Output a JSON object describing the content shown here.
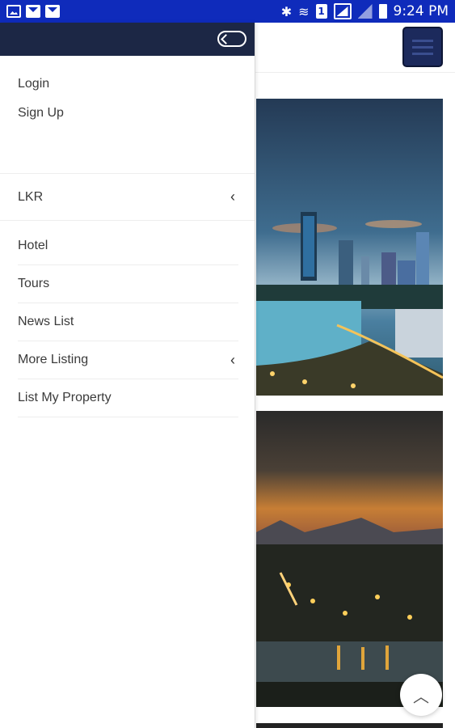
{
  "statusbar": {
    "time": "9:24 PM",
    "sim_label": "1",
    "icons": [
      "image-icon",
      "mail-icon",
      "mail-icon",
      "bluetooth-icon",
      "wifi-icon",
      "sim-icon",
      "signal-icon",
      "signal-icon",
      "battery-icon"
    ]
  },
  "drawer": {
    "auth": {
      "login": "Login",
      "signup": "Sign Up"
    },
    "currency": {
      "label": "LKR"
    },
    "menu": [
      {
        "label": "Hotel"
      },
      {
        "label": "Tours"
      },
      {
        "label": "News List"
      },
      {
        "label": "More Listing"
      },
      {
        "label": "List My Property"
      }
    ]
  },
  "glyphs": {
    "chevron_left": "‹",
    "chevron_up": "︿",
    "bluetooth": "✱",
    "wifi": "≋"
  },
  "colors": {
    "statusbar": "#0f2bbb",
    "drawer_header": "#1c2745",
    "menu_button": "#1c2a5c"
  }
}
